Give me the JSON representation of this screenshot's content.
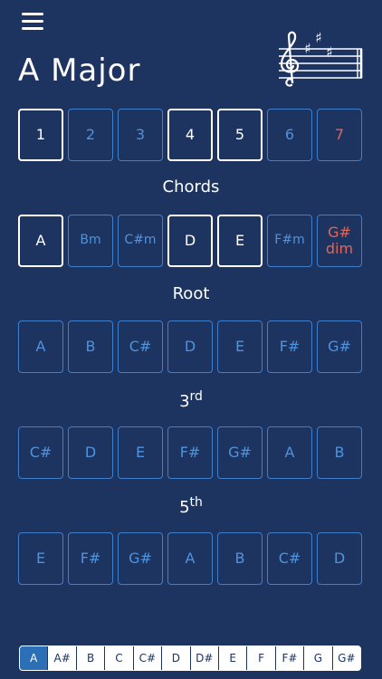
{
  "header": {
    "title": "A Major"
  },
  "degrees": [
    {
      "label": "1",
      "state": "active"
    },
    {
      "label": "2",
      "state": "normal"
    },
    {
      "label": "3",
      "state": "normal"
    },
    {
      "label": "4",
      "state": "active"
    },
    {
      "label": "5",
      "state": "active"
    },
    {
      "label": "6",
      "state": "normal"
    },
    {
      "label": "7",
      "state": "dim"
    }
  ],
  "chords_section": {
    "label": "Chords",
    "items": [
      {
        "label": "A",
        "state": "active"
      },
      {
        "label": "Bm",
        "state": "normal"
      },
      {
        "label": "C#m",
        "state": "normal"
      },
      {
        "label": "D",
        "state": "active"
      },
      {
        "label": "E",
        "state": "active"
      },
      {
        "label": "F#m",
        "state": "normal"
      },
      {
        "label": "G#\ndim",
        "state": "dim"
      }
    ]
  },
  "root_section": {
    "label": "Root",
    "items": [
      "A",
      "B",
      "C#",
      "D",
      "E",
      "F#",
      "G#"
    ]
  },
  "third_section": {
    "label_num": "3",
    "label_sup": "rd",
    "items": [
      "C#",
      "D",
      "E",
      "F#",
      "G#",
      "A",
      "B"
    ]
  },
  "fifth_section": {
    "label_num": "5",
    "label_sup": "th",
    "items": [
      "E",
      "F#",
      "G#",
      "A",
      "B",
      "C#",
      "D"
    ]
  },
  "key_selector": {
    "items": [
      "A",
      "A#",
      "B",
      "C",
      "C#",
      "D",
      "D#",
      "E",
      "F",
      "F#",
      "G",
      "G#"
    ],
    "selected_index": 0
  },
  "colors": {
    "background": "#1d3461",
    "accent": "#4f93dd",
    "border": "#3f7fcb",
    "active": "#ffffff",
    "dim": "#e0665a",
    "selected_key": "#2b6fb7"
  },
  "icons": {
    "menu": "hamburger-menu-icon",
    "key_signature": "treble-clef-three-sharps-icon"
  }
}
